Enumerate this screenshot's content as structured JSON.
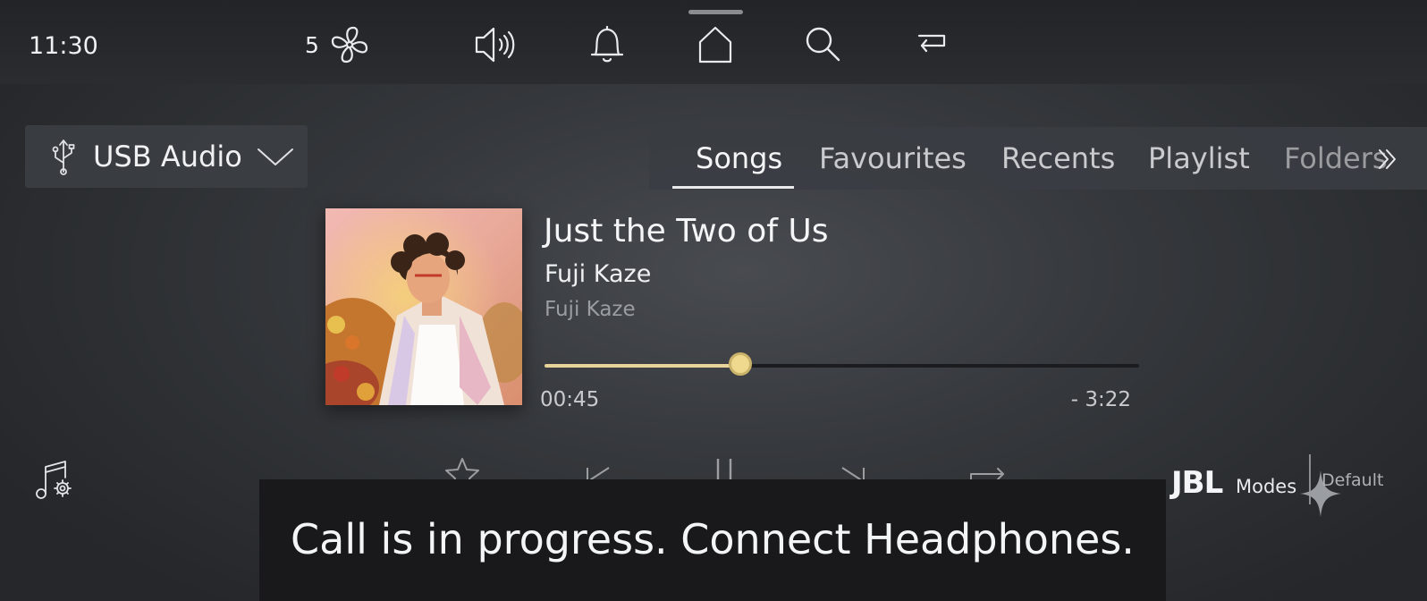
{
  "status_bar": {
    "time": "11:30",
    "fan_level": "5",
    "icons": [
      "fan-icon",
      "volume-icon",
      "bell-icon",
      "home-icon",
      "search-icon",
      "back-icon"
    ]
  },
  "source": {
    "label": "USB Audio",
    "icon": "usb-icon"
  },
  "tabs": [
    "Songs",
    "Favourites",
    "Recents",
    "Playlist",
    "Folders"
  ],
  "active_tab": "Songs",
  "now_playing": {
    "title": "Just the Two of Us",
    "artist": "Fuji Kaze",
    "album": "Fuji Kaze",
    "elapsed": "00:45",
    "remaining": "- 3:22",
    "progress": 0.33
  },
  "controls": [
    "favourite-star-icon",
    "previous-track-icon",
    "pause-icon",
    "next-track-icon",
    "repeat-icon"
  ],
  "audio": {
    "brand": "JBL",
    "modes_label": "Modes",
    "mode_value": "Default"
  },
  "toast": {
    "message": "Call is in progress. Connect Headphones."
  },
  "colors": {
    "accent": "#e8d49a",
    "knob": "#eed98e",
    "toast_bg": "#19191b"
  }
}
